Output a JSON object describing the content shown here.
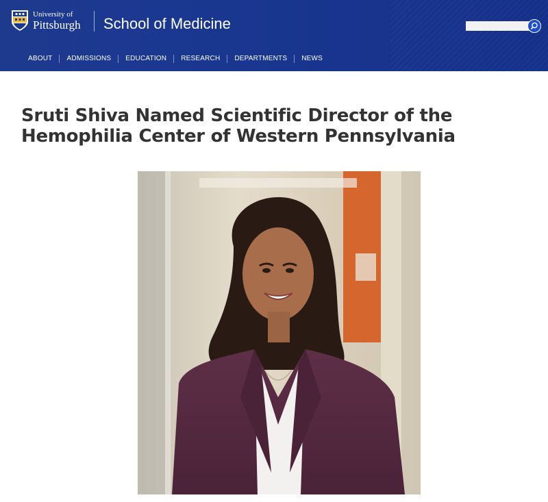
{
  "header": {
    "university_line1": "University of",
    "university_line2": "Pittsburgh",
    "school": "School of Medicine",
    "search_placeholder": ""
  },
  "nav": {
    "items": [
      {
        "label": "ABOUT"
      },
      {
        "label": "ADMISSIONS"
      },
      {
        "label": "EDUCATION"
      },
      {
        "label": "RESEARCH"
      },
      {
        "label": "DEPARTMENTS"
      },
      {
        "label": "NEWS"
      }
    ]
  },
  "article": {
    "title": "Sruti Shiva Named Scientific Director of the Hemophilia Center of Western Pennsylvania"
  },
  "colors": {
    "header_bg": "#1a3790",
    "accent": "#1f4fd1",
    "title_text": "#333333"
  }
}
